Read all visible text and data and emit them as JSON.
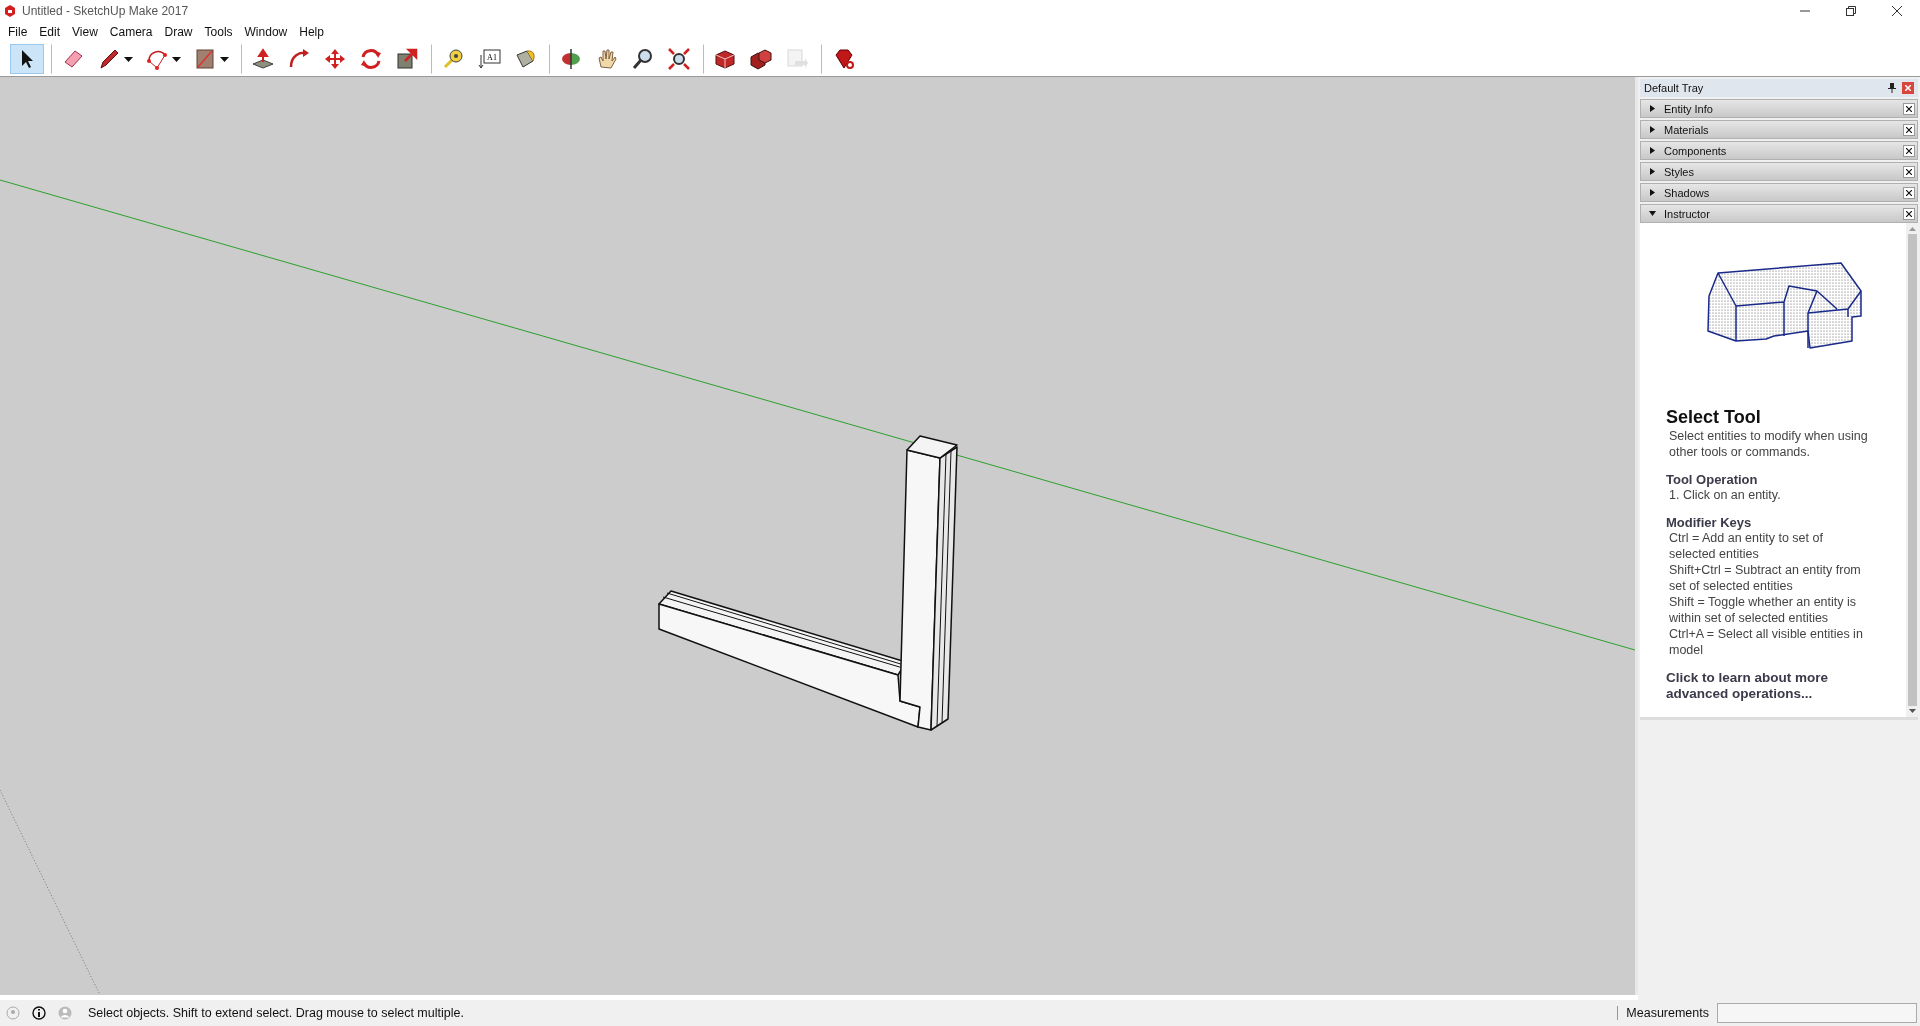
{
  "window": {
    "title": "Untitled - SketchUp Make 2017"
  },
  "menu": [
    "File",
    "Edit",
    "View",
    "Camera",
    "Draw",
    "Tools",
    "Window",
    "Help"
  ],
  "toolbar": [
    {
      "selected": true,
      "dropdown": false,
      "disabled": false,
      "separator_before": false
    },
    {
      "selected": false,
      "dropdown": false,
      "disabled": false,
      "separator_before": true
    },
    {
      "selected": false,
      "dropdown": true,
      "disabled": false,
      "separator_before": false
    },
    {
      "selected": false,
      "dropdown": true,
      "disabled": false,
      "separator_before": false
    },
    {
      "selected": false,
      "dropdown": true,
      "disabled": false,
      "separator_before": false
    },
    {
      "selected": false,
      "dropdown": false,
      "disabled": false,
      "separator_before": true
    },
    {
      "selected": false,
      "dropdown": false,
      "disabled": false,
      "separator_before": false
    },
    {
      "selected": false,
      "dropdown": false,
      "disabled": false,
      "separator_before": false
    },
    {
      "selected": false,
      "dropdown": false,
      "disabled": false,
      "separator_before": false
    },
    {
      "selected": false,
      "dropdown": false,
      "disabled": false,
      "separator_before": false
    },
    {
      "selected": false,
      "dropdown": false,
      "disabled": false,
      "separator_before": true
    },
    {
      "selected": false,
      "dropdown": false,
      "disabled": false,
      "separator_before": false,
      "label": "A1"
    },
    {
      "selected": false,
      "dropdown": false,
      "disabled": false,
      "separator_before": false
    },
    {
      "selected": false,
      "dropdown": false,
      "disabled": false,
      "separator_before": true
    },
    {
      "selected": false,
      "dropdown": false,
      "disabled": false,
      "separator_before": false
    },
    {
      "selected": false,
      "dropdown": false,
      "disabled": false,
      "separator_before": false
    },
    {
      "selected": false,
      "dropdown": false,
      "disabled": false,
      "separator_before": false
    },
    {
      "selected": false,
      "dropdown": false,
      "disabled": false,
      "separator_before": true
    },
    {
      "selected": false,
      "dropdown": false,
      "disabled": false,
      "separator_before": false
    },
    {
      "selected": false,
      "dropdown": false,
      "disabled": true,
      "separator_before": false
    },
    {
      "selected": false,
      "dropdown": false,
      "disabled": false,
      "separator_before": true
    }
  ],
  "tray": {
    "title": "Default Tray",
    "panels": [
      {
        "label": "Entity Info",
        "expanded": false
      },
      {
        "label": "Materials",
        "expanded": false
      },
      {
        "label": "Components",
        "expanded": false
      },
      {
        "label": "Styles",
        "expanded": false
      },
      {
        "label": "Shadows",
        "expanded": false
      },
      {
        "label": "Instructor",
        "expanded": true
      }
    ],
    "instructor": {
      "heading": "Select Tool",
      "description": "Select entities to modify when using other tools or commands.",
      "sections": [
        {
          "title": "Tool Operation",
          "lines": [
            "1. Click on an entity."
          ]
        },
        {
          "title": "Modifier Keys",
          "lines": [
            "Ctrl = Add an entity to set of selected entities",
            "Shift+Ctrl = Subtract an entity from set of selected entities",
            "Shift = Toggle whether an entity is within set of selected entities",
            "Ctrl+A = Select all visible entities in model"
          ]
        }
      ],
      "link": "Click to learn about more advanced operations..."
    }
  },
  "status_bar": {
    "message": "Select objects. Shift to extend select. Drag mouse to select multiple.",
    "measurements_label": "Measurements"
  }
}
